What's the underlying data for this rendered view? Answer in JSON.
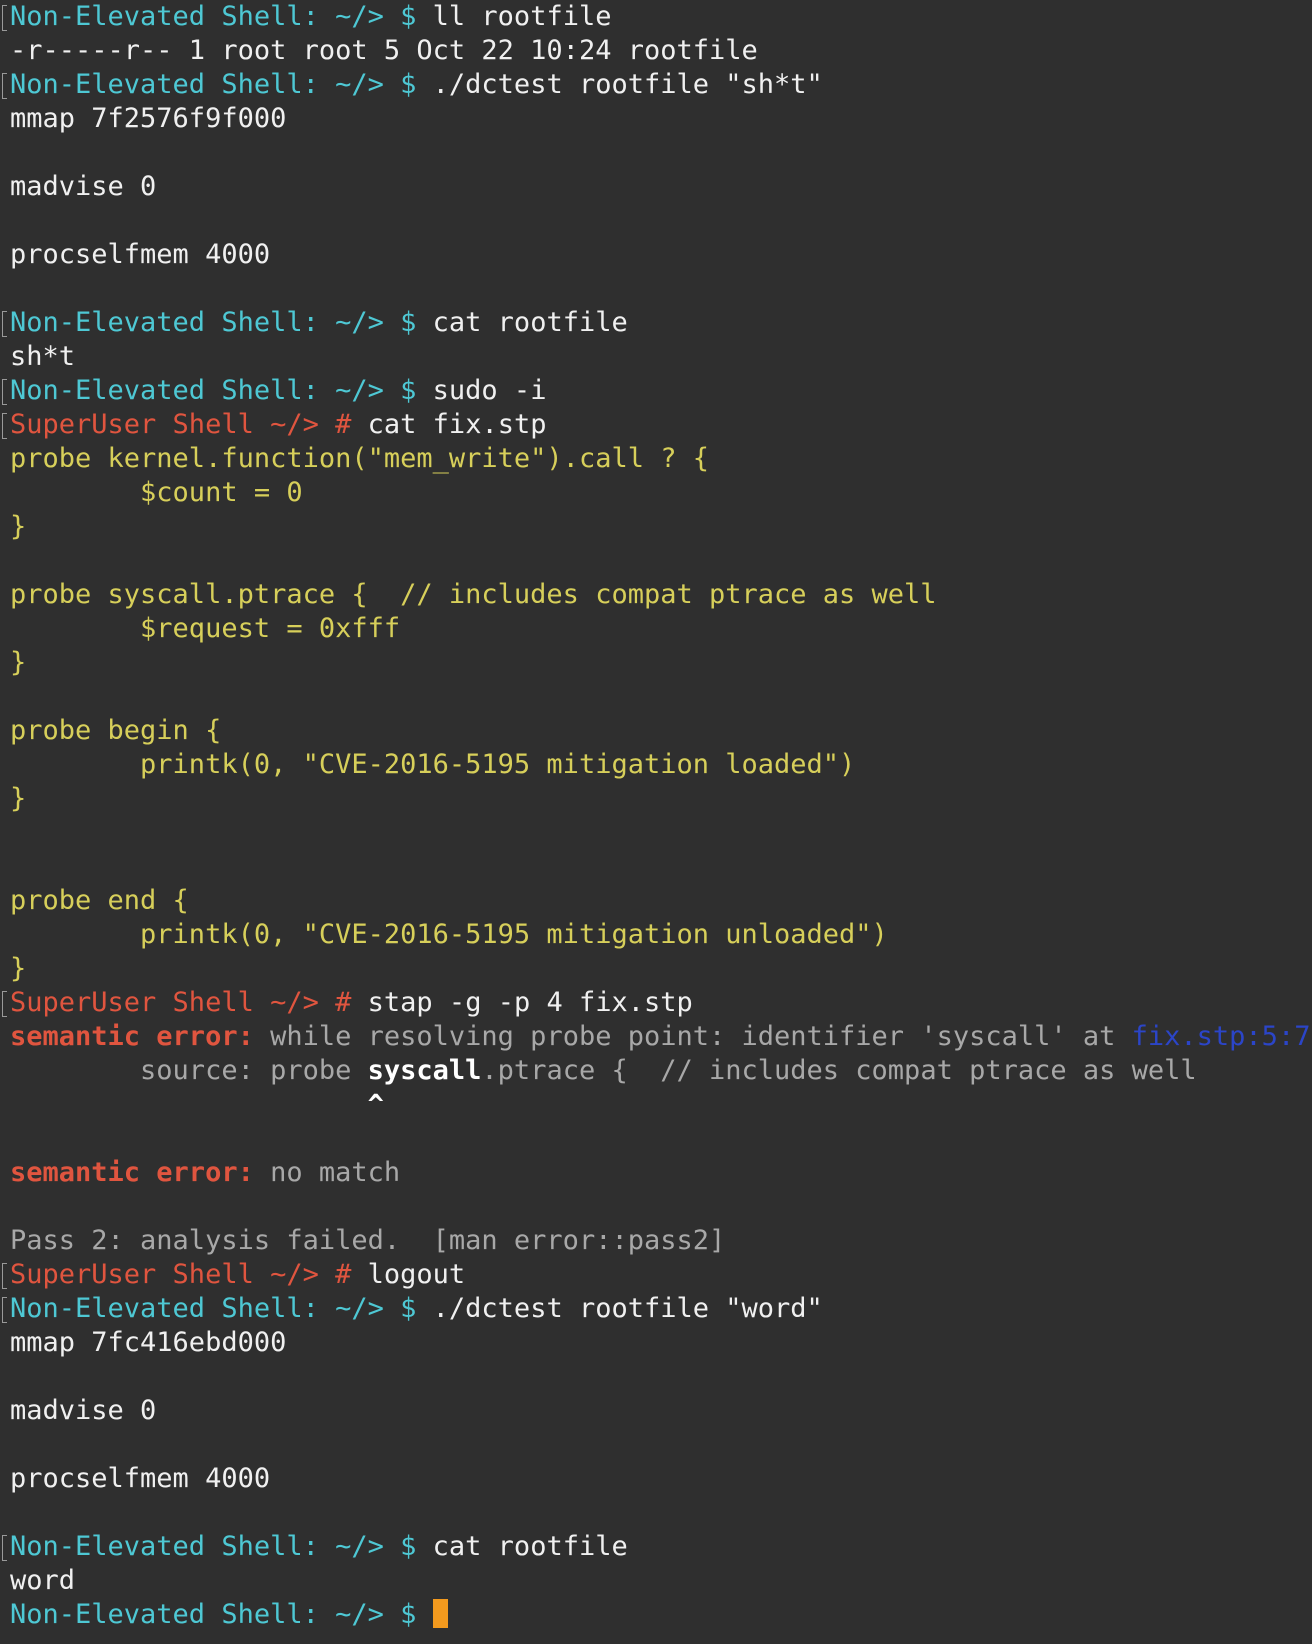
{
  "terminal": {
    "user_prompt": "Non-Elevated Shell: ~/> $",
    "root_prompt_name": "SuperUser Shell ~/>",
    "root_symbol": "#",
    "lines": [
      {
        "kind": "user",
        "cmd": "ll rootfile"
      },
      {
        "kind": "out",
        "text": "-r-----r-- 1 root root 5 Oct 22 10:24 rootfile"
      },
      {
        "kind": "user",
        "cmd": "./dctest rootfile \"sh*t\""
      },
      {
        "kind": "out",
        "text": "mmap 7f2576f9f000"
      },
      {
        "kind": "blank"
      },
      {
        "kind": "out",
        "text": "madvise 0"
      },
      {
        "kind": "blank"
      },
      {
        "kind": "out",
        "text": "procselfmem 4000"
      },
      {
        "kind": "blank"
      },
      {
        "kind": "user",
        "cmd": "cat rootfile"
      },
      {
        "kind": "out",
        "text": "sh*t"
      },
      {
        "kind": "user",
        "cmd": "sudo -i"
      },
      {
        "kind": "root",
        "cmd": "cat fix.stp"
      },
      {
        "kind": "code",
        "text": "probe kernel.function(\"mem_write\").call ? {"
      },
      {
        "kind": "code",
        "text": "        $count = 0"
      },
      {
        "kind": "code",
        "text": "}"
      },
      {
        "kind": "blank"
      },
      {
        "kind": "code",
        "text": "probe syscall.ptrace {  // includes compat ptrace as well"
      },
      {
        "kind": "code",
        "text": "        $request = 0xfff"
      },
      {
        "kind": "code",
        "text": "}"
      },
      {
        "kind": "blank"
      },
      {
        "kind": "code",
        "text": "probe begin {"
      },
      {
        "kind": "code",
        "text": "        printk(0, \"CVE-2016-5195 mitigation loaded\")"
      },
      {
        "kind": "code",
        "text": "}"
      },
      {
        "kind": "blank"
      },
      {
        "kind": "blank"
      },
      {
        "kind": "code",
        "text": "probe end {"
      },
      {
        "kind": "code",
        "text": "        printk(0, \"CVE-2016-5195 mitigation unloaded\")"
      },
      {
        "kind": "code",
        "text": "}"
      },
      {
        "kind": "root",
        "cmd": "stap -g -p 4 fix.stp"
      },
      {
        "kind": "error",
        "label": "semantic error:",
        "text": " while resolving probe point: identifier 'syscall' at ",
        "link": "fix.stp:5:7"
      },
      {
        "kind": "source",
        "pre": "        source: probe ",
        "hl": "syscall",
        "post": ".ptrace {  // includes compat ptrace as well"
      },
      {
        "kind": "caret",
        "pad": "                      ",
        "mark": "^"
      },
      {
        "kind": "blank"
      },
      {
        "kind": "error",
        "label": "semantic error:",
        "text": " no match",
        "link": ""
      },
      {
        "kind": "blank"
      },
      {
        "kind": "dim",
        "text": "Pass 2: analysis failed.  [man error::pass2]"
      },
      {
        "kind": "root",
        "cmd": "logout"
      },
      {
        "kind": "user",
        "cmd": "./dctest rootfile \"word\""
      },
      {
        "kind": "out",
        "text": "mmap 7fc416ebd000"
      },
      {
        "kind": "blank"
      },
      {
        "kind": "out",
        "text": "madvise 0"
      },
      {
        "kind": "blank"
      },
      {
        "kind": "out",
        "text": "procselfmem 4000"
      },
      {
        "kind": "blank"
      },
      {
        "kind": "user",
        "cmd": "cat rootfile"
      },
      {
        "kind": "out",
        "text": "word"
      },
      {
        "kind": "user-cursor",
        "cmd": ""
      }
    ]
  },
  "colors": {
    "background": "#2f2f2f",
    "user_prompt": "#4ec8d4",
    "root_prompt": "#e0553f",
    "code": "#d7cf5a",
    "link": "#2b45c8",
    "cursor": "#f39a1e"
  }
}
